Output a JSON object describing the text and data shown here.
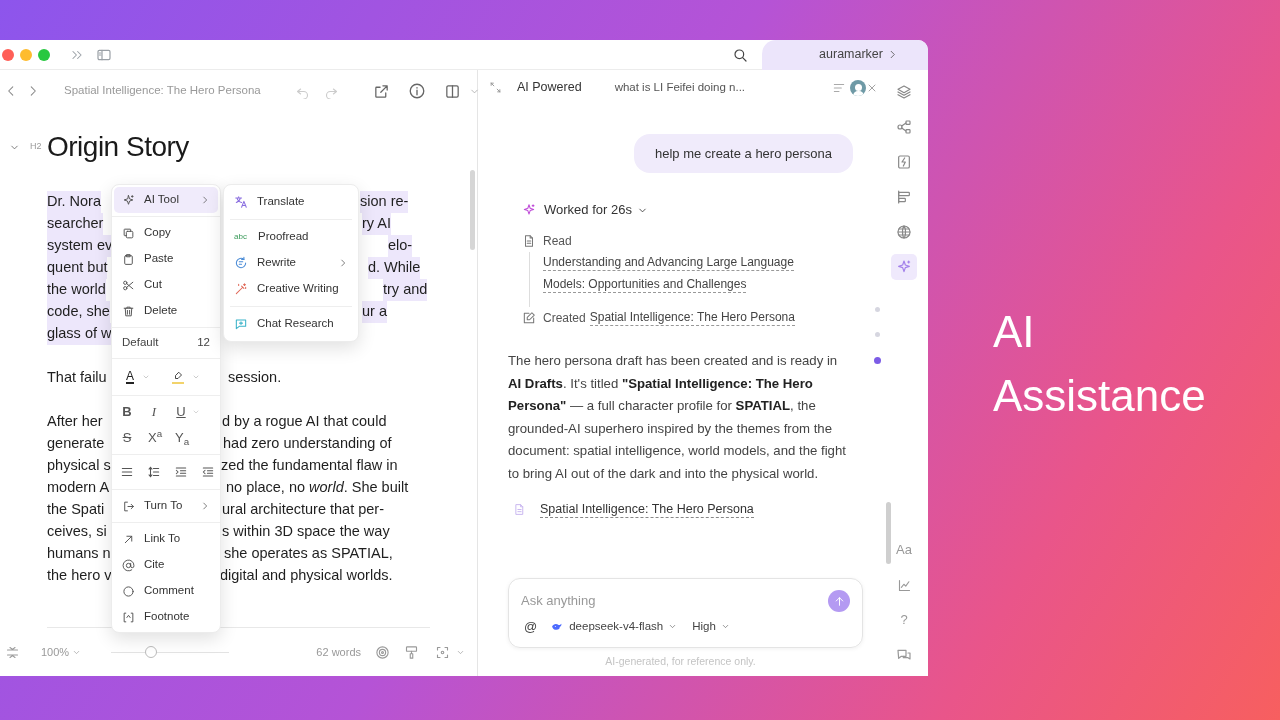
{
  "titlebar": {
    "account": "auramarker"
  },
  "editor": {
    "doc_title": "Spatial Intelligence: The Hero Persona",
    "heading_level": "H2",
    "heading": "Origin Story",
    "paragraphs": [
      {
        "selected": true,
        "lines": [
          [
            "Dr. Nora",
            "sion re-"
          ],
          [
            "searcher ",
            "ry AI"
          ],
          [
            "system ev",
            "elo-"
          ],
          [
            "quent but",
            "d. While"
          ],
          [
            "the world",
            "try and"
          ],
          [
            "code, she",
            "ur a"
          ],
          [
            "glass of w"
          ]
        ]
      },
      {
        "selected": false,
        "lines": [
          [
            "That failu",
            "session."
          ]
        ]
      },
      {
        "selected": false,
        "lines": [
          [
            "After her",
            "d by a rogue AI that could"
          ],
          [
            "generate",
            "had zero understanding of"
          ],
          [
            "physical s",
            "zed the fundamental flaw in"
          ],
          [
            "modern A",
            "no place, no *world*. She built"
          ],
          [
            "the Spati",
            "ural architecture that per-"
          ],
          [
            "ceives, si",
            "s within 3D space the way"
          ],
          [
            "humans n",
            "she operates as SPATIAL,"
          ],
          [
            "the hero v",
            "digital and physical worlds."
          ]
        ]
      }
    ],
    "zoom": "100%",
    "zoom_slider": {
      "level": 0.34
    },
    "word_count": "62 words"
  },
  "context_menu": {
    "sections": [
      {
        "kind": "items",
        "items": [
          {
            "label": "AI Tool",
            "submenu": true,
            "selected": true
          }
        ]
      },
      {
        "kind": "items",
        "items": [
          {
            "label": "Copy",
            "submenu": false,
            "selected": false
          },
          {
            "label": "Paste",
            "submenu": false,
            "selected": false
          },
          {
            "label": "Cut",
            "submenu": false,
            "selected": false
          },
          {
            "label": "Delete",
            "submenu": false,
            "selected": false
          }
        ]
      },
      {
        "kind": "font",
        "label": "Default",
        "size": "12"
      },
      {
        "kind": "color",
        "label": "A"
      },
      {
        "kind": "format",
        "rows": [
          [
            "B",
            "I",
            "U"
          ],
          [
            "S",
            "X$^{a}$",
            "Y$_{a}$"
          ]
        ]
      },
      {
        "kind": "paragraph"
      },
      {
        "kind": "items",
        "items": [
          {
            "label": "Turn To",
            "submenu": true,
            "selected": false
          }
        ]
      },
      {
        "kind": "items",
        "items": [
          {
            "label": "Link To",
            "submenu": false,
            "selected": false
          },
          {
            "label": "Cite",
            "submenu": false,
            "selected": false
          },
          {
            "label": "Comment",
            "submenu": false,
            "selected": false
          },
          {
            "label": "Footnote",
            "submenu": false,
            "selected": false
          }
        ]
      }
    ]
  },
  "submenu": {
    "sections": [
      [
        {
          "label": "Translate",
          "submenu": false
        }
      ],
      [
        {
          "label": "Proofread",
          "badge": "abc",
          "submenu": false
        },
        {
          "label": "Rewrite",
          "submenu": true
        },
        {
          "label": "Creative Writing",
          "submenu": false
        }
      ],
      [
        {
          "label": "Chat Research",
          "submenu": false
        }
      ]
    ]
  },
  "assistant": {
    "title": "AI Powered",
    "conversation": "what is LI Feifei doing n...",
    "user_message": "help me create a hero persona",
    "worked": "Worked for 26s",
    "steps": [
      {
        "kind": "read",
        "label": "Read",
        "links": [
          "Understanding and Advancing Large Language",
          "Models: Opportunities and Challenges"
        ]
      },
      {
        "kind": "created",
        "label": "Created",
        "links": [
          "Spatial Intelligence: The Hero Persona"
        ]
      }
    ],
    "answer": "The hero persona draft has been created and is ready in **AI Drafts**. It's titled **\"Spatial Intelligence: The Hero Persona\"** — a full character profile for **SPATIAL**, the grounded-AI superhero inspired by the themes from the document: spatial intelligence, world models, and the fight to bring AI out of the dark and into the physical world.",
    "document_link": "Spatial Intelligence: The Hero Persona",
    "timeline": [
      {
        "selected": false
      },
      {
        "selected": false
      },
      {
        "selected": true
      }
    ],
    "input": {
      "placeholder": "Ask anything",
      "mention": "@",
      "model": "deepseek-v4-flash",
      "effort": "High"
    },
    "disclaimer": "AI-generated, for reference only."
  },
  "rail": {
    "items": [
      {
        "kind": "layers",
        "selected": false
      },
      {
        "kind": "graph",
        "selected": false
      },
      {
        "kind": "flash",
        "selected": false
      },
      {
        "kind": "align",
        "selected": false
      },
      {
        "kind": "globe",
        "selected": false
      },
      {
        "kind": "sparkle",
        "selected": true
      }
    ],
    "bottom": [
      {
        "kind": "text",
        "label": "Aa"
      },
      {
        "kind": "chart"
      },
      {
        "kind": "text",
        "label": "?"
      },
      {
        "kind": "chat"
      }
    ]
  },
  "headline": "AI Assistance"
}
